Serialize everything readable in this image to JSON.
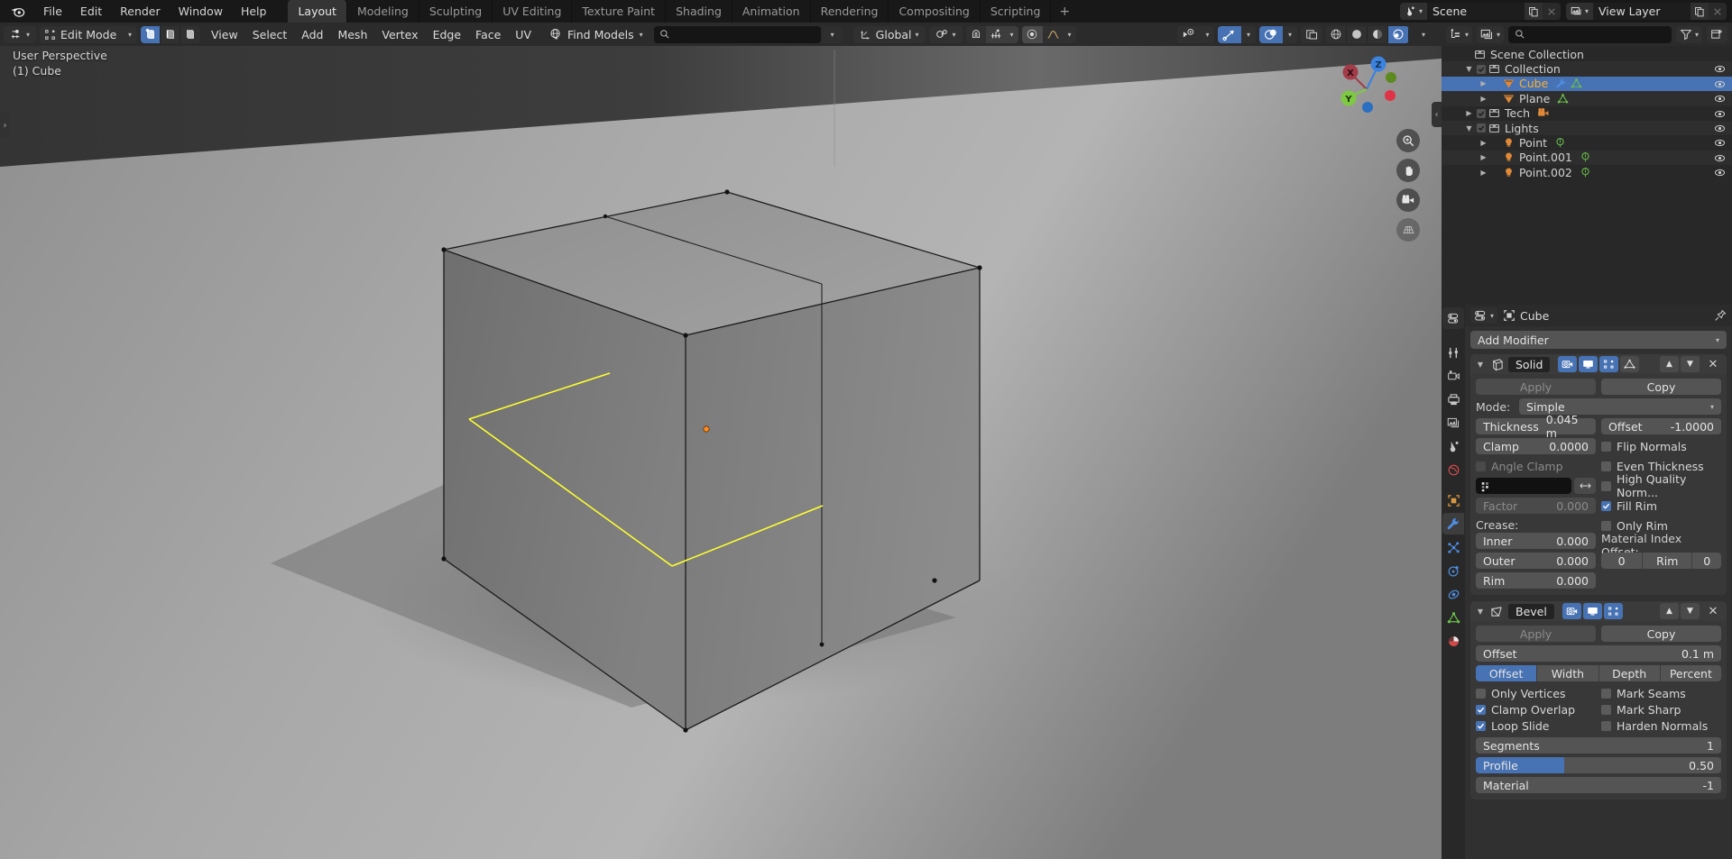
{
  "app": {
    "menus": [
      "File",
      "Edit",
      "Render",
      "Window",
      "Help"
    ],
    "workspaces": [
      "Layout",
      "Modeling",
      "Sculpting",
      "UV Editing",
      "Texture Paint",
      "Shading",
      "Animation",
      "Rendering",
      "Compositing",
      "Scripting"
    ],
    "active_workspace": "Layout",
    "add_workspace": "+",
    "scene_name": "Scene",
    "view_layer_name": "View Layer",
    "accent": "#4772b3",
    "select_color": "#ffaf29"
  },
  "viewport": {
    "mode": "Edit Mode",
    "mesh_select_modes": [
      "vertex-select",
      "edge-select",
      "face-select"
    ],
    "active_select_mode": "vertex-select",
    "menus": [
      "View",
      "Select",
      "Add",
      "Mesh",
      "Vertex",
      "Edge",
      "Face",
      "UV"
    ],
    "addon_label": "Find Models",
    "search_placeholder": "",
    "transform_orientation": "Global",
    "overlay_perspective": "User Perspective",
    "overlay_object": "(1) Cube",
    "gizmo_axes": [
      "Z",
      "X",
      "Y"
    ],
    "shading_modes": [
      "wireframe",
      "solid",
      "material-preview",
      "rendered"
    ],
    "active_shading": "rendered",
    "tool_buttons": [
      "zoom-tool",
      "pan-tool",
      "camera-view-tool",
      "toggle-ortho-tool"
    ]
  },
  "outliner": {
    "display_mode": "view-layer",
    "filter_label": "",
    "search_placeholder": "",
    "rows": [
      {
        "name": "Scene Collection",
        "depth": 0,
        "icon": "collection-icon",
        "tri": "",
        "check": false,
        "selected": false,
        "extras": [],
        "eye": false
      },
      {
        "name": "Collection",
        "depth": 1,
        "icon": "collection-icon",
        "tri": "down",
        "check": true,
        "selected": false,
        "extras": [],
        "eye": true
      },
      {
        "name": "Cube",
        "depth": 2,
        "icon": "mesh-data-icon",
        "tri": "right",
        "check": false,
        "selected": true,
        "extras": [
          "wrench-icon",
          "mesh-triangle-icon"
        ],
        "eye": true
      },
      {
        "name": "Plane",
        "depth": 2,
        "icon": "mesh-data-icon",
        "tri": "right",
        "check": false,
        "selected": false,
        "extras": [
          "mesh-triangle-icon"
        ],
        "eye": true
      },
      {
        "name": "Tech",
        "depth": 1,
        "icon": "collection-icon",
        "tri": "right",
        "check": true,
        "selected": false,
        "extras": [
          "camera-icon"
        ],
        "eye": true
      },
      {
        "name": "Lights",
        "depth": 1,
        "icon": "collection-icon",
        "tri": "down",
        "check": true,
        "selected": false,
        "extras": [],
        "eye": true
      },
      {
        "name": "Point",
        "depth": 2,
        "icon": "light-icon",
        "tri": "right",
        "check": false,
        "selected": false,
        "extras": [
          "light-data-icon"
        ],
        "eye": true
      },
      {
        "name": "Point.001",
        "depth": 2,
        "icon": "light-icon",
        "tri": "right",
        "check": false,
        "selected": false,
        "extras": [
          "light-data-icon"
        ],
        "eye": true
      },
      {
        "name": "Point.002",
        "depth": 2,
        "icon": "light-icon",
        "tri": "right",
        "check": false,
        "selected": false,
        "extras": [
          "light-data-icon"
        ],
        "eye": true
      }
    ]
  },
  "properties": {
    "editor_tabs": [
      "tool-icon",
      "render-icon",
      "output-icon",
      "view-layer-icon",
      "scene-icon",
      "world-icon",
      "object-icon",
      "modifier-icon",
      "particles-icon",
      "physics-icon",
      "constraints-icon",
      "data-icon",
      "material-icon"
    ],
    "active_tab": "modifier-icon",
    "breadcrumb_object": "Cube",
    "add_modifier_label": "Add Modifier",
    "modifiers": [
      {
        "name": "Solid",
        "type": "solidify",
        "apply_label": "Apply",
        "copy_label": "Copy",
        "mode_label": "Mode:",
        "mode_value": "Simple",
        "thickness_label": "Thickness",
        "thickness_value": "0.045 m",
        "offset_label": "Offset",
        "offset_value": "-1.0000",
        "clamp_label": "Clamp",
        "clamp_value": "0.0000",
        "flip_normals_label": "Flip Normals",
        "flip_normals": false,
        "angle_clamp_label": "Angle Clamp",
        "angle_clamp": false,
        "even_thickness_label": "Even Thickness",
        "even_thickness": false,
        "hq_normals_label": "High Quality Norm...",
        "hq_normals": false,
        "vertex_group": "",
        "factor_label": "Factor",
        "factor_value": "0.000",
        "fill_rim_label": "Fill Rim",
        "fill_rim": true,
        "only_rim_label": "Only Rim",
        "only_rim": false,
        "crease_label": "Crease:",
        "inner_label": "Inner",
        "inner_value": "0.000",
        "outer_label": "Outer",
        "outer_value": "0.000",
        "rim_label": "Rim",
        "rim_value": "0.000",
        "material_index_label": "Material Index Offset:",
        "mat_offset_value": "0",
        "mat_rim_label": "Rim",
        "mat_rim_value": "0",
        "toggles": [
          true,
          true,
          true,
          false
        ]
      },
      {
        "name": "Bevel",
        "type": "bevel",
        "apply_label": "Apply",
        "copy_label": "Copy",
        "offset_label": "Offset",
        "offset_value": "0.1 m",
        "width_types": [
          "Offset",
          "Width",
          "Depth",
          "Percent"
        ],
        "active_width_type": "Offset",
        "only_vertices_label": "Only Vertices",
        "only_vertices": false,
        "clamp_overlap_label": "Clamp Overlap",
        "clamp_overlap": true,
        "loop_slide_label": "Loop Slide",
        "loop_slide": true,
        "mark_seams_label": "Mark Seams",
        "mark_seams": false,
        "mark_sharp_label": "Mark Sharp",
        "mark_sharp": false,
        "harden_normals_label": "Harden Normals",
        "harden_normals": false,
        "segments_label": "Segments",
        "segments_value": "1",
        "profile_label": "Profile",
        "profile_value": "0.50",
        "profile_fill": 36,
        "material_label": "Material",
        "material_value": "-1",
        "toggles": [
          true,
          true,
          true
        ]
      }
    ]
  }
}
